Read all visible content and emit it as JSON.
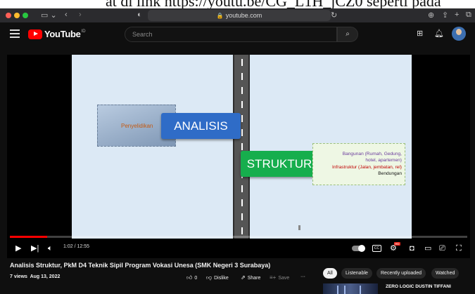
{
  "doc_strip": {
    "text": "at di link https://youtu.be/CG_L1H_jCZ0 seperti pada"
  },
  "browser": {
    "url": "youtube.com",
    "icons": [
      "sidebar-icon",
      "back-icon",
      "forward-icon",
      "shield-icon",
      "reload-icon",
      "download-icon",
      "share-icon",
      "new-tab-icon",
      "tab-overview-icon"
    ]
  },
  "header": {
    "logo_text": "YouTube",
    "logo_region": "ID",
    "search_placeholder": "Search",
    "icons": [
      "menu-icon",
      "search-icon",
      "create-icon",
      "bell-icon",
      "avatar"
    ]
  },
  "video": {
    "slide": {
      "penyelidikan": "Penyelidikan",
      "analisis": "ANALISIS",
      "struktur": "STRUKTUR",
      "info_line1": "Bangunan (Rumah, Gedung,",
      "info_line2": "hotel, apartemen)",
      "info_line3": "Infrastruktur (Jalan, jembatan, rel)",
      "info_line4": "Bendungan"
    },
    "progress": 0.082,
    "time": "1:02 / 12:55",
    "hd_badge": "HD",
    "cc_label": "CC",
    "colors": {
      "analisis": "#2f6cc7",
      "struktur": "#16ae4d",
      "progress": "#ff0000",
      "info_red": "#c00000",
      "info_purple": "#6a3b9c",
      "penyelidikan": "#c55a11"
    }
  },
  "info": {
    "title": "Analisis Struktur, PkM D4 Teknik Sipil Program Vokasi Unesa (SMK Negeri 3 Surabaya)",
    "views": "7 views",
    "date": "Aug 13, 2022",
    "like_count": "0",
    "dislike_label": "Dislike",
    "share_label": "Share",
    "save_label": "Save",
    "more_label": "···"
  },
  "filters": [
    "All",
    "Listenable",
    "Recently uploaded",
    "Watched"
  ],
  "recommended": {
    "title": "ZERO LOGIC DUSTIN TIFFANI"
  }
}
